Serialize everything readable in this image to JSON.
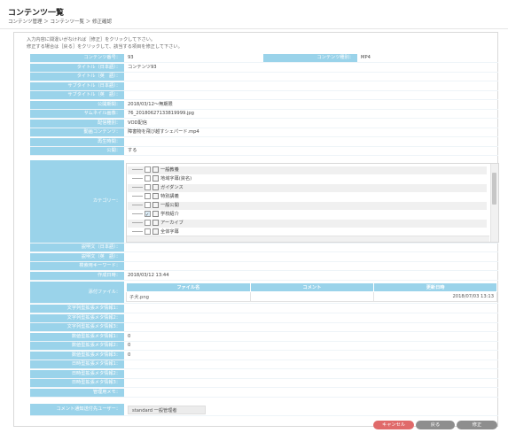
{
  "header": {
    "title": "コンテンツ一覧",
    "breadcrumb": "コンテンツ管理 ＞ コンテンツ一覧 ＞ 修正確認"
  },
  "notice": {
    "line1": "入力内容に間違いがなければ［修正］をクリックして下さい。",
    "line2": "修正する場合は［戻る］をクリックして、該当する項目を修正して下さい。"
  },
  "fields": {
    "content_no": {
      "label": "コンテンツ番号：",
      "value": "93"
    },
    "content_type": {
      "label": "コンテンツ種別：",
      "value": "MP4"
    },
    "title_ja": {
      "label": "タイトル（日本語）：",
      "value": "コンテンツ93"
    },
    "title_en": {
      "label": "タイトル（英　語）：",
      "value": ""
    },
    "subtitle_ja": {
      "label": "サブタイトル（日本語）：",
      "value": ""
    },
    "subtitle_en": {
      "label": "サブタイトル（英　語）：",
      "value": ""
    },
    "period": {
      "label": "公開期間：",
      "value": "2018/03/12～無期限"
    },
    "thumbnail": {
      "label": "サムネイル画像：",
      "value": "76_20180627133819999.jpg"
    },
    "delivery": {
      "label": "配信種別：",
      "value": "VOD配信"
    },
    "video": {
      "label": "動画コンテンツ：",
      "value": "障害物を飛び越すシェパード.mp4"
    },
    "play_time": {
      "label": "再生時間：",
      "value": ""
    },
    "publish": {
      "label": "公開：",
      "value": "する"
    },
    "category": {
      "label": "カテゴリー："
    },
    "desc_ja": {
      "label": "説明文（日本語）：",
      "value": ""
    },
    "desc_en": {
      "label": "説明文（英　語）：",
      "value": ""
    },
    "keywords": {
      "label": "検索用キーワード：",
      "value": ""
    },
    "created": {
      "label": "作成日時：",
      "value": "2018/03/12 13:44"
    },
    "attachments": {
      "label": "添付ファイル："
    },
    "str_meta1": {
      "label": "文字列型拡張メタ情報1：",
      "value": ""
    },
    "str_meta2": {
      "label": "文字列型拡張メタ情報2：",
      "value": ""
    },
    "str_meta3": {
      "label": "文字列型拡張メタ情報3：",
      "value": ""
    },
    "num_meta1": {
      "label": "数値型拡張メタ情報1：",
      "value": "0"
    },
    "num_meta2": {
      "label": "数値型拡張メタ情報2：",
      "value": "0"
    },
    "num_meta3": {
      "label": "数値型拡張メタ情報3：",
      "value": "0"
    },
    "date_meta1": {
      "label": "日時型拡張メタ情報1：",
      "value": ""
    },
    "date_meta2": {
      "label": "日時型拡張メタ情報2：",
      "value": ""
    },
    "date_meta3": {
      "label": "日時型拡張メタ情報3：",
      "value": ""
    },
    "admin_memo": {
      "label": "管理用メモ：",
      "value": ""
    },
    "comment_users": {
      "label": "コメント通知送付先ユーザー：",
      "value": "standard 一般管理者"
    }
  },
  "category_tree": [
    {
      "label": "一般教養",
      "checked": false
    },
    {
      "label": "地域字幕(資名)",
      "checked": false
    },
    {
      "label": "ガイダンス",
      "checked": false
    },
    {
      "label": "特別講義",
      "checked": false
    },
    {
      "label": "一般公開",
      "checked": false
    },
    {
      "label": "学校紹介",
      "checked": true
    },
    {
      "label": "アーカイブ",
      "checked": false
    },
    {
      "label": "全体字幕",
      "checked": false
    }
  ],
  "attachments_table": {
    "headers": [
      "ファイル名",
      "コメント",
      "更新日時"
    ],
    "rows": [
      [
        "子犬.png",
        "",
        "2018/07/03 13:13"
      ]
    ]
  },
  "buttons": {
    "cancel": "キャンセル",
    "back": "戻る",
    "edit": "修正"
  },
  "colors": {
    "label_bg": "#9ad3ea",
    "cancel": "#e06a6a",
    "neutral": "#8e8e8e"
  }
}
